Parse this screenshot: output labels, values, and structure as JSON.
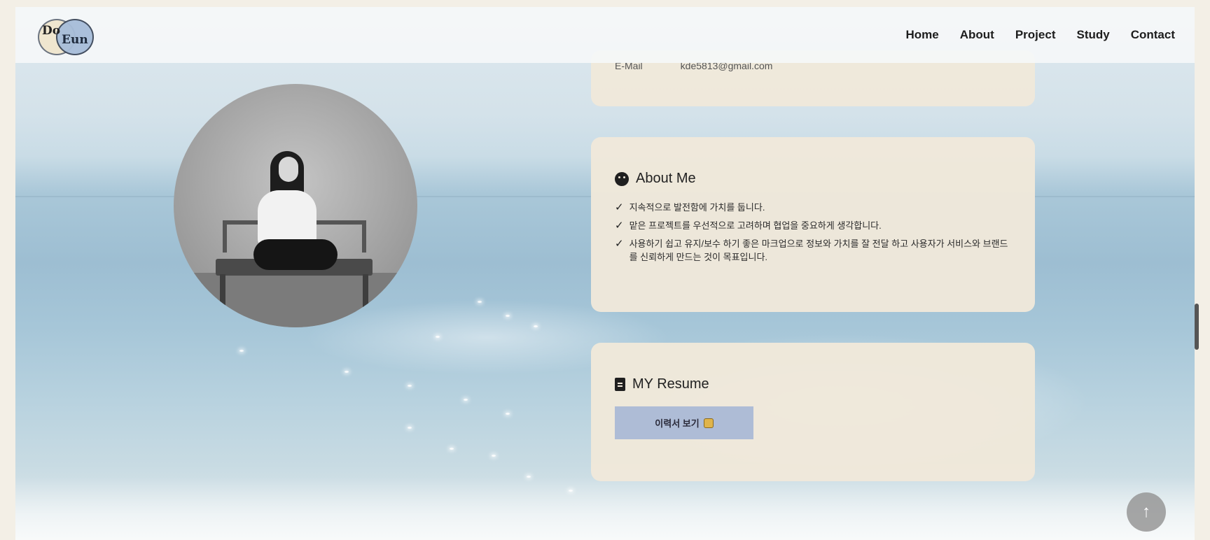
{
  "brand": {
    "logo_text_1": "Do",
    "logo_text_2": "Eun"
  },
  "nav": {
    "items": [
      "Home",
      "About",
      "Project",
      "Study",
      "Contact"
    ]
  },
  "contact": {
    "label": "E-Mail",
    "value": "kde5813@gmail.com"
  },
  "about": {
    "title": "About Me",
    "icon": "smile-icon",
    "items": [
      "지속적으로 발전함에 가치를 둡니다.",
      "맡은 프로젝트를 우선적으로 고려하며 협업을 중요하게 생각합니다.",
      "사용하기 쉽고 유지/보수 하기 좋은 마크업으로 정보와 가치를 잘 전달 하고 사용자가 서비스와 브랜드를 신뢰하게 만드는 것이 목표입니다."
    ]
  },
  "resume": {
    "title": "MY Resume",
    "icon": "file-icon",
    "button_label": "이력서 보기"
  },
  "back_to_top": {
    "glyph": "↑"
  },
  "colors": {
    "card_bg": "#f0e8da",
    "button_bg": "#aebcd6",
    "page_bg": "#f3efe6"
  }
}
